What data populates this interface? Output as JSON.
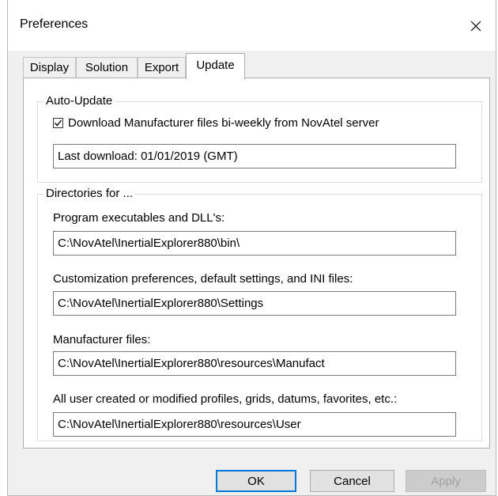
{
  "window": {
    "title": "Preferences"
  },
  "tabs": [
    {
      "label": "Display",
      "active": false
    },
    {
      "label": "Solution",
      "active": false
    },
    {
      "label": "Export",
      "active": false
    },
    {
      "label": "Update",
      "active": true
    }
  ],
  "auto_update": {
    "legend": "Auto-Update",
    "checkbox_label": "Download Manufacturer files bi-weekly from NovAtel server",
    "checked": true,
    "last_download": "Last download: 01/01/2019 (GMT)"
  },
  "directories": {
    "legend": "Directories for ...",
    "items": [
      {
        "label": "Program executables and DLL's:",
        "value": "C:\\NovAtel\\InertialExplorer880\\bin\\"
      },
      {
        "label": "Customization preferences, default settings, and INI files:",
        "value": "C:\\NovAtel\\InertialExplorer880\\Settings"
      },
      {
        "label": "Manufacturer files:",
        "value": "C:\\NovAtel\\InertialExplorer880\\resources\\Manufact"
      },
      {
        "label": "All user created or modified profiles, grids, datums, favorites, etc.:",
        "value": "C:\\NovAtel\\InertialExplorer880\\resources\\User"
      }
    ]
  },
  "buttons": {
    "ok": "OK",
    "cancel": "Cancel",
    "apply": "Apply"
  },
  "icons": {
    "close": "close-icon",
    "check": "check-icon"
  }
}
